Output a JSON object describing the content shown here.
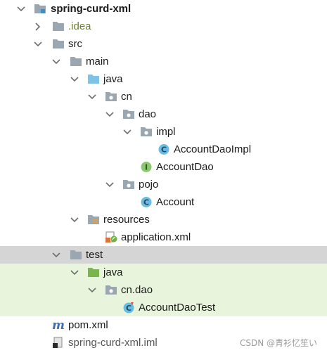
{
  "tree": {
    "root": "spring-curd-xml",
    "idea": ".idea",
    "src": "src",
    "main": "main",
    "main_java": "java",
    "cn": "cn",
    "dao": "dao",
    "impl": "impl",
    "account_dao_impl": "AccountDaoImpl",
    "account_dao": "AccountDao",
    "pojo": "pojo",
    "account": "Account",
    "resources": "resources",
    "application_xml": "application.xml",
    "test": "test",
    "test_java": "java",
    "cn_dao": "cn.dao",
    "account_dao_test": "AccountDaoTest",
    "pom_xml": "pom.xml",
    "iml": "spring-curd-xml.iml"
  },
  "icons": {
    "class_letter": "C",
    "interface_letter": "I",
    "maven_letter": "m"
  },
  "watermark": "CSDN @青衫忆笙い",
  "colors": {
    "selected_row": "#d5d5d5",
    "test_row": "#e8f5dc",
    "folder": "#9aa7b0",
    "source_folder": "#7ec3e6",
    "test_folder": "#78b84b",
    "class_icon": "#6bbce0",
    "interface_icon": "#8bc76f"
  }
}
